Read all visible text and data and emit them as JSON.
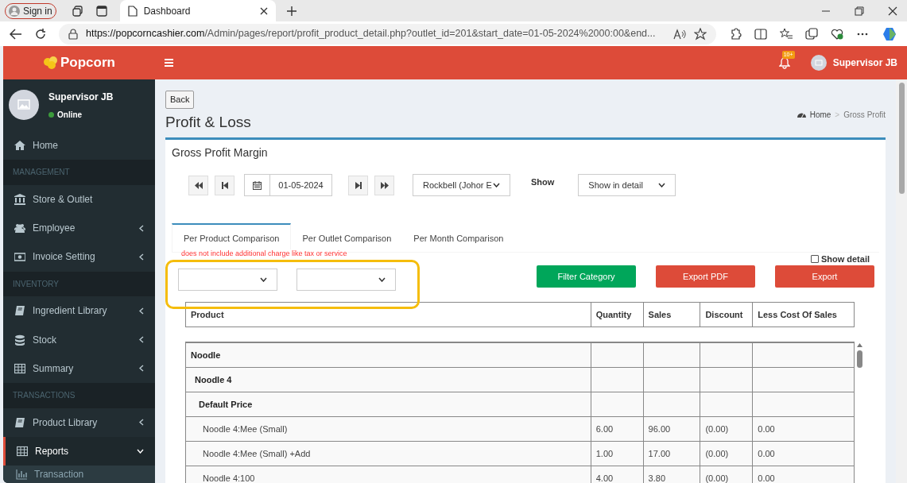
{
  "browser": {
    "sign_in": "Sign in",
    "tab_title": "Dashboard",
    "url_host": "https://popcorncashier.com",
    "url_path": "/Admin/pages/report/profit_product_detail.php?outlet_id=201&start_date=01-05-2024%2000:00&end..."
  },
  "header": {
    "logo": "Popcorn",
    "badge": "10+",
    "user": "Supervisor JB"
  },
  "sidebar": {
    "user": "Supervisor JB",
    "status": "Online",
    "items": [
      {
        "kind": "item",
        "label": "Home",
        "selected": false
      },
      {
        "kind": "header",
        "label": "MANAGEMENT"
      },
      {
        "kind": "item",
        "label": "Store & Outlet",
        "selected": false
      },
      {
        "kind": "item",
        "label": "Employee",
        "expanded": false,
        "selected": false
      },
      {
        "kind": "item",
        "label": "Invoice Setting",
        "expanded": false,
        "selected": false
      },
      {
        "kind": "header",
        "label": "INVENTORY"
      },
      {
        "kind": "item",
        "label": "Ingredient Library",
        "expanded": false,
        "selected": false
      },
      {
        "kind": "item",
        "label": "Stock",
        "expanded": false,
        "selected": false
      },
      {
        "kind": "item",
        "label": "Summary",
        "expanded": false,
        "selected": false
      },
      {
        "kind": "header",
        "label": "TRANSACTIONS"
      },
      {
        "kind": "item",
        "label": "Product Library",
        "expanded": false,
        "selected": false
      },
      {
        "kind": "item",
        "label": "Reports",
        "expanded": true,
        "selected": true
      },
      {
        "kind": "sub",
        "label": "Transaction",
        "selected": false
      }
    ]
  },
  "page": {
    "back": "Back",
    "title": "Profit & Loss",
    "breadcrumb": [
      "Home",
      "Gross Profit"
    ],
    "breadcrumb_separator": ">",
    "card_title": "Gross Profit Margin",
    "date": "01-05-2024",
    "outlet": "Rockbell (Johor E",
    "show_label": "Show",
    "show_select": "Show in detail",
    "tabs": [
      {
        "label": "Per Product Comparison",
        "selected": true
      },
      {
        "label": "Per Outlet Comparison",
        "selected": false
      },
      {
        "label": "Per Month Comparison",
        "selected": false
      }
    ],
    "note": "does not include additional charge like tax or service",
    "show_detail": {
      "label": "Show detail",
      "checked": false
    },
    "buttons": [
      {
        "label": "Filter Category",
        "kind": "success"
      },
      {
        "label": "Export PDF",
        "kind": "danger"
      },
      {
        "label": "Export",
        "kind": "danger"
      }
    ],
    "table": {
      "columns": [
        "Product",
        "Quantity",
        "Sales",
        "Discount",
        "Less Cost Of Sales"
      ],
      "rows": [
        {
          "name": "Noodle",
          "children": [
            {
              "name": "Noodle 4",
              "children": [
                {
                  "name": "Default Price",
                  "children": [
                    {
                      "name": "Noodle 4:Mee (Small)",
                      "cells": [
                        "6.00",
                        "96.00",
                        "(0.00)",
                        "0.00"
                      ]
                    },
                    {
                      "name": "Noodle 4:Mee (Small) +Add",
                      "cells": [
                        "1.00",
                        "17.00",
                        "(0.00)",
                        "0.00"
                      ]
                    },
                    {
                      "name": "Noodle 4:100",
                      "cells": [
                        "4.00",
                        "3.80",
                        "(0.00)",
                        "0.00"
                      ]
                    }
                  ]
                }
              ]
            }
          ]
        }
      ]
    }
  }
}
